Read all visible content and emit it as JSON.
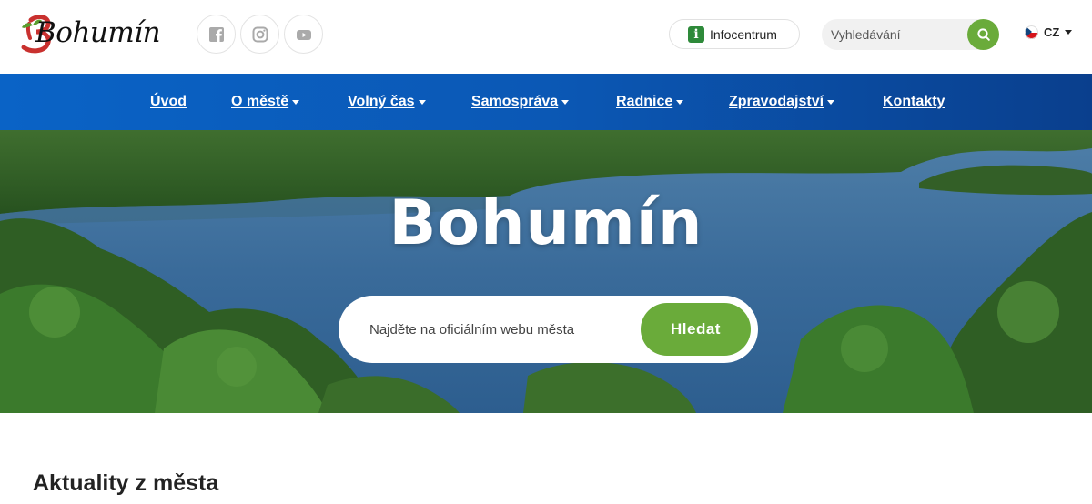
{
  "header": {
    "logo_text": "Bohumín",
    "social": [
      {
        "icon": "facebook-icon"
      },
      {
        "icon": "instagram-icon"
      },
      {
        "icon": "youtube-icon"
      }
    ],
    "infocentrum_label": "Infocentrum",
    "search_placeholder": "Vyhledávání",
    "language": "CZ"
  },
  "nav": {
    "items": [
      {
        "label": "Úvod",
        "dropdown": false
      },
      {
        "label": "O městě",
        "dropdown": true
      },
      {
        "label": "Volný čas",
        "dropdown": true
      },
      {
        "label": "Samospráva",
        "dropdown": true
      },
      {
        "label": "Radnice",
        "dropdown": true
      },
      {
        "label": "Zpravodajství",
        "dropdown": true
      },
      {
        "label": "Kontakty",
        "dropdown": false
      }
    ]
  },
  "hero": {
    "title": "Bohumín",
    "search_placeholder": "Najděte na oficiálním webu města",
    "search_button": "Hledat"
  },
  "content": {
    "news_heading": "Aktuality z města"
  },
  "colors": {
    "accent_green": "#6aab3a",
    "nav_blue": "#0a5ab8",
    "info_green": "#2e8a3a"
  }
}
